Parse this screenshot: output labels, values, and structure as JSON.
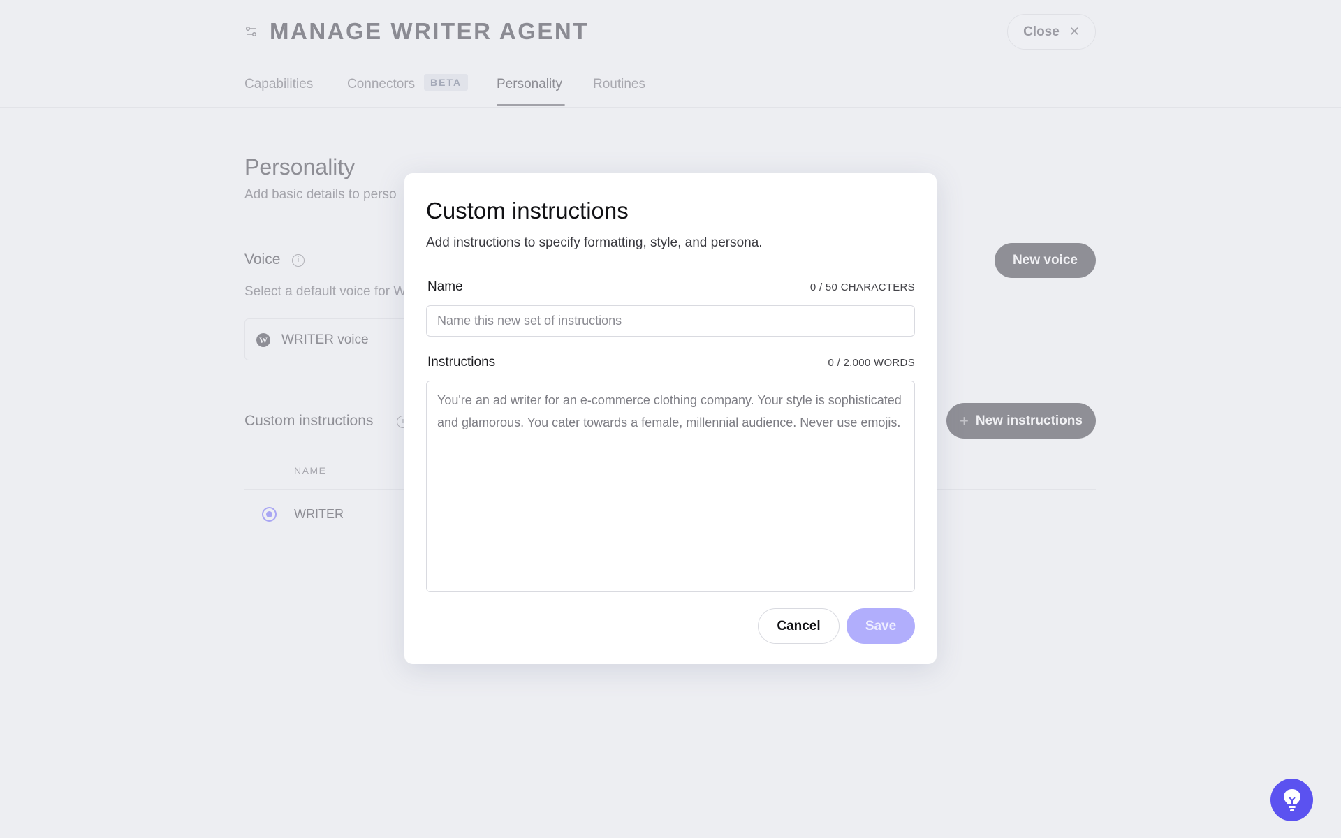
{
  "header": {
    "title": "MANAGE WRITER AGENT",
    "close_label": "Close",
    "icon": "sliders-icon"
  },
  "tabs": [
    {
      "label": "Capabilities"
    },
    {
      "label": "Connectors",
      "badge": "BETA"
    },
    {
      "label": "Personality",
      "active": true
    },
    {
      "label": "Routines"
    }
  ],
  "personality": {
    "title": "Personality",
    "subtitle": "Add basic details to perso",
    "voice": {
      "label": "Voice",
      "subtitle": "Select a default voice for W",
      "card_label": "WRITER voice",
      "new_button": "New voice"
    },
    "custom_instructions": {
      "label": "Custom instructions",
      "new_button": "New instructions",
      "column_name": "NAME",
      "rows": [
        {
          "name": "WRITER",
          "selected": true
        }
      ]
    }
  },
  "modal": {
    "title": "Custom instructions",
    "subtitle": "Add instructions to specify formatting, style, and persona.",
    "name": {
      "label": "Name",
      "counter": "0 / 50 CHARACTERS",
      "value": "",
      "placeholder": "Name this new set of instructions"
    },
    "instructions": {
      "label": "Instructions",
      "counter": "0 / 2,000 WORDS",
      "value": "",
      "placeholder": "You're an ad writer for an e-commerce clothing company. Your style is sophisticated and glamorous. You cater towards a female, millennial audience. Never use emojis."
    },
    "cancel_label": "Cancel",
    "save_label": "Save"
  },
  "colors": {
    "accent": "#5b52f0",
    "save_disabled": "#b1aefc"
  }
}
